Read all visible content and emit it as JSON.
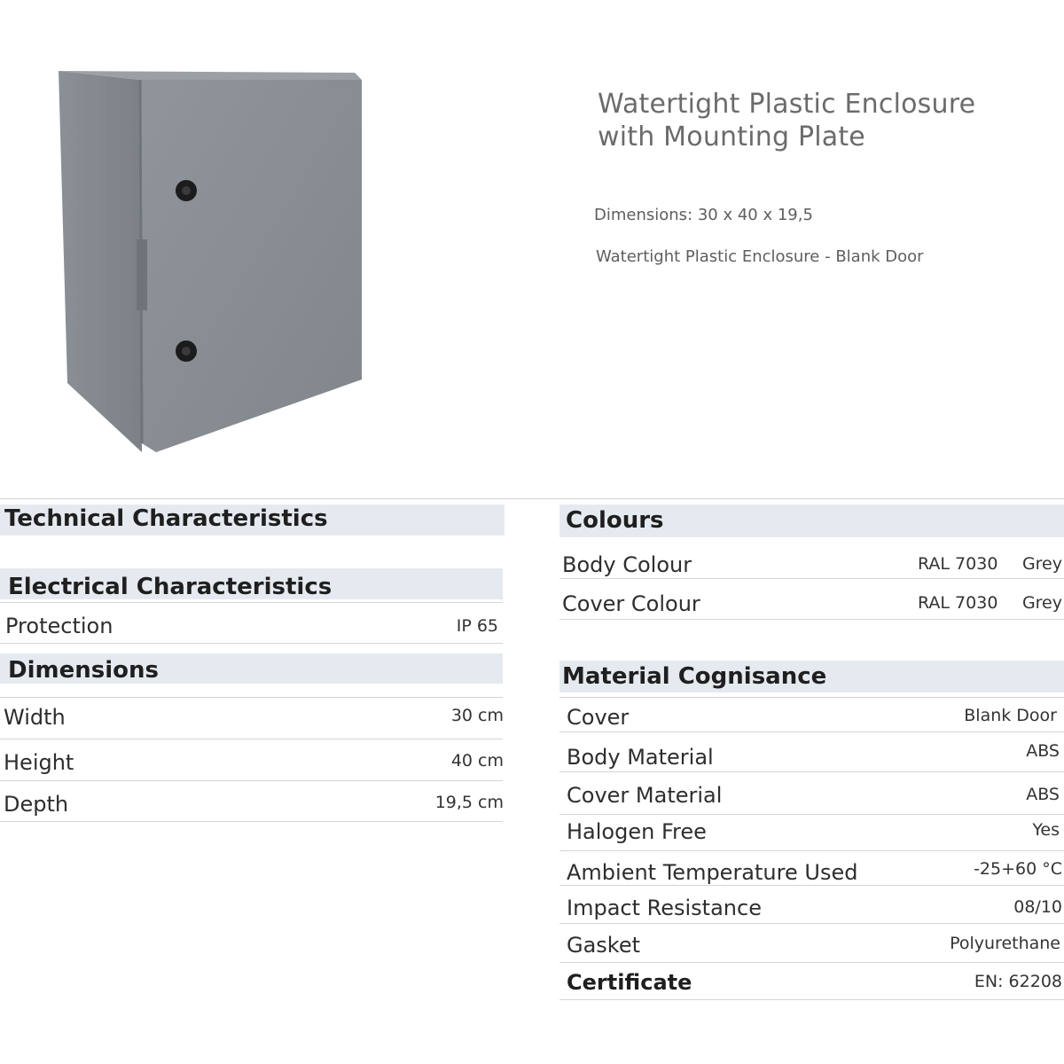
{
  "product": {
    "title_line1": "Watertight Plastic Enclosure",
    "title_line2": "with Mounting Plate",
    "dimensions": "Dimensions: 30 x 40 x 19,5",
    "variant": "Watertight Plastic Enclosure - Blank Door",
    "image_color": "#878d93"
  },
  "technical": {
    "heading": "Technical Characteristics",
    "electrical": {
      "heading": "Electrical Characteristics",
      "rows": [
        {
          "label": "Protection",
          "value": "IP 65"
        }
      ]
    },
    "dimensions": {
      "heading": "Dimensions",
      "rows": [
        {
          "label": "Width",
          "value": "30 cm"
        },
        {
          "label": "Height",
          "value": "40 cm"
        },
        {
          "label": "Depth",
          "value": "19,5 cm"
        }
      ]
    }
  },
  "colours": {
    "heading": "Colours",
    "rows": [
      {
        "label": "Body Colour",
        "code": "RAL 7030",
        "name": "Grey"
      },
      {
        "label": "Cover Colour",
        "code": "RAL 7030",
        "name": "Grey"
      }
    ]
  },
  "material": {
    "heading": "Material Cognisance",
    "rows": [
      {
        "label": "Cover",
        "value": "Blank Door"
      },
      {
        "label": "Body Material",
        "value": "ABS"
      },
      {
        "label": "Cover Material",
        "value": "ABS"
      },
      {
        "label": "Halogen Free",
        "value": "Yes"
      },
      {
        "label": "Ambient Temperature Used",
        "value": "-25+60 °C"
      },
      {
        "label": "Impact Resistance",
        "value": "08/10"
      },
      {
        "label": "Gasket",
        "value": "Polyurethane"
      },
      {
        "label": "Certificate",
        "value": "EN: 62208"
      }
    ]
  },
  "theme": {
    "header_band": "#e5eaf0",
    "rule": "#d5d5d5"
  }
}
